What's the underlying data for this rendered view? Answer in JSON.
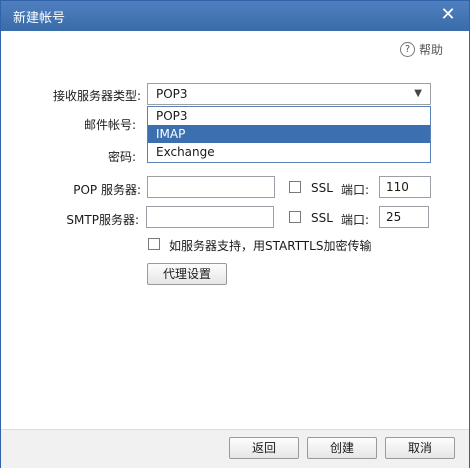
{
  "window": {
    "title": "新建帐号"
  },
  "help": {
    "label": "帮助",
    "icon": "question-circle-icon"
  },
  "labels": {
    "server_type": "接收服务器类型:",
    "email": "邮件帐号:",
    "password": "密码:",
    "pop_server": "POP 服务器:",
    "smtp_server": "SMTP服务器:",
    "ssl": "SSL",
    "port": "端口:"
  },
  "server_type": {
    "selected": "POP3",
    "options": [
      "POP3",
      "IMAP",
      "Exchange"
    ],
    "highlighted": "IMAP"
  },
  "pop": {
    "server": "",
    "ssl": false,
    "port": "110"
  },
  "smtp": {
    "server": "",
    "ssl": false,
    "port": "25"
  },
  "starttls": {
    "label": "如服务器支持，用STARTTLS加密传输",
    "checked": false
  },
  "buttons": {
    "proxy": "代理设置",
    "back": "返回",
    "create": "创建",
    "cancel": "取消"
  }
}
